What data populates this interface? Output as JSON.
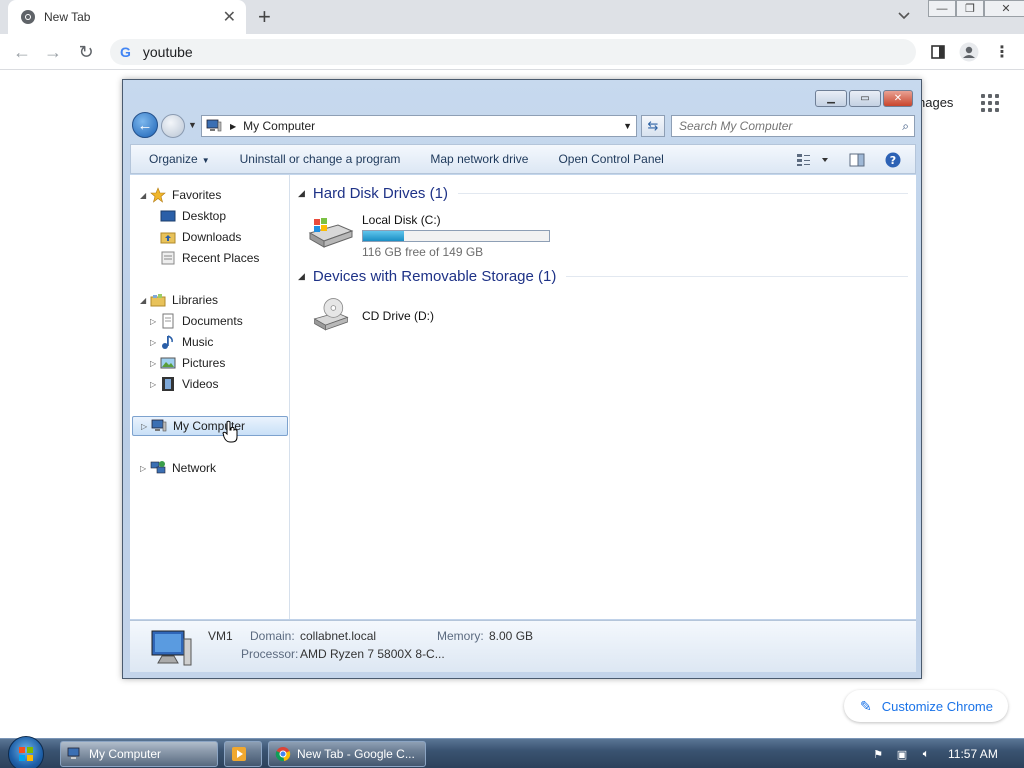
{
  "browser": {
    "tab_title": "New Tab",
    "omnibox_value": "youtube",
    "ntp_images_link": "nages",
    "customize_label": "Customize Chrome"
  },
  "explorer": {
    "address_crumb": "My Computer",
    "search_placeholder": "Search My Computer",
    "commands": {
      "organize": "Organize",
      "uninstall": "Uninstall or change a program",
      "map_drive": "Map network drive",
      "control_panel": "Open Control Panel"
    },
    "nav": {
      "favorites": "Favorites",
      "desktop": "Desktop",
      "downloads": "Downloads",
      "recent": "Recent Places",
      "libraries": "Libraries",
      "documents": "Documents",
      "music": "Music",
      "pictures": "Pictures",
      "videos": "Videos",
      "computer": "My Computer",
      "network": "Network"
    },
    "groups": {
      "hdd_header": "Hard Disk Drives (1)",
      "removable_header": "Devices with Removable Storage (1)"
    },
    "drives": {
      "c_name": "Local Disk (C:)",
      "c_free": "116 GB free of 149 GB",
      "c_used_fraction": 0.22,
      "d_name": "CD Drive (D:)"
    },
    "details": {
      "name": "VM1",
      "domain_label": "Domain:",
      "domain": "collabnet.local",
      "memory_label": "Memory:",
      "memory": "8.00 GB",
      "processor_label": "Processor:",
      "processor": "AMD Ryzen 7 5800X 8-C..."
    }
  },
  "taskbar": {
    "task_explorer": "My Computer",
    "task_chrome": "New Tab - Google C...",
    "clock": "11:57 AM"
  },
  "colors": {
    "accent_blue": "#1a73e8",
    "group_header": "#1e3287",
    "drive_fill": "#1a8ec4"
  }
}
